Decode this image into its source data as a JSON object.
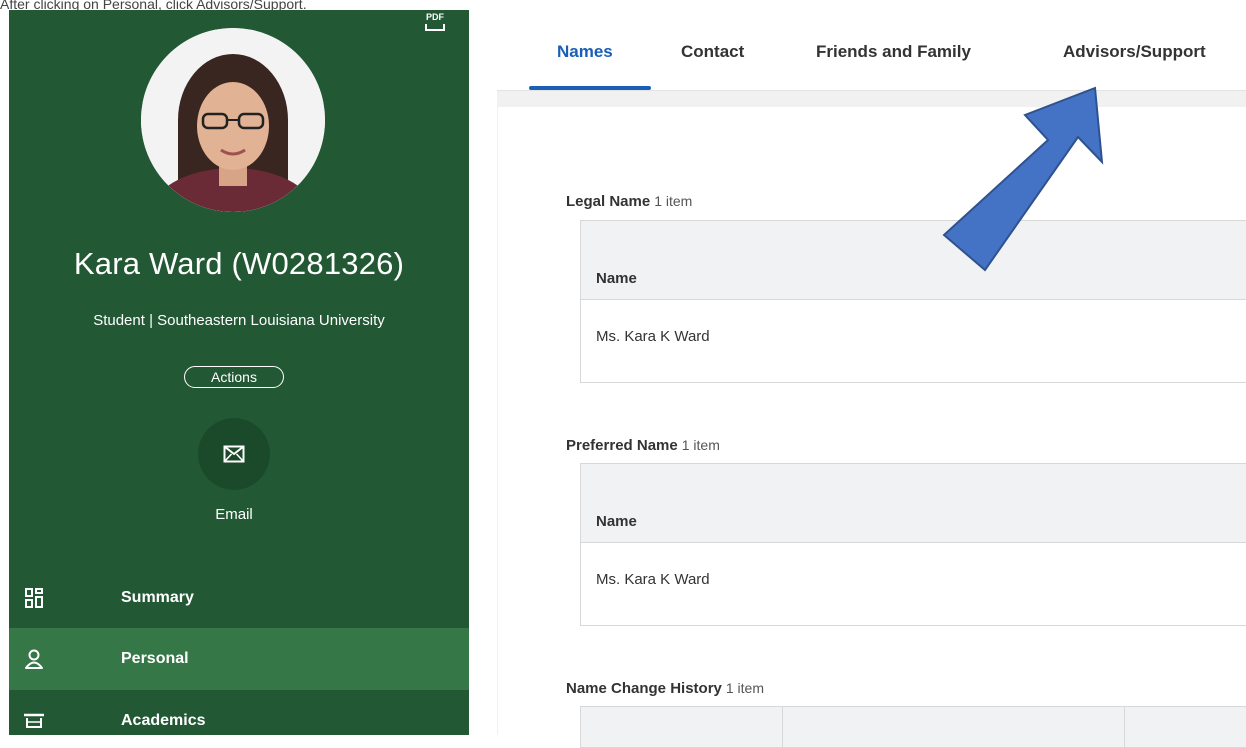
{
  "caption": "After clicking on Personal, click Advisors/Support.",
  "colors": {
    "sidebar": "#235834",
    "sidebar_active": "#357747",
    "tab_active": "#1a5fb4",
    "arrow": "#4472c4"
  },
  "profile": {
    "pdf_icon": "pdf-icon",
    "name": "Kara Ward (W0281326)",
    "subtitle": "Student | Southeastern Louisiana University",
    "actions_label": "Actions",
    "email_label": "Email"
  },
  "nav": {
    "items": [
      {
        "label": "Summary",
        "icon": "grid-icon",
        "active": false
      },
      {
        "label": "Personal",
        "icon": "person-icon",
        "active": true
      },
      {
        "label": "Academics",
        "icon": "mortarboard-icon",
        "active": false
      }
    ]
  },
  "tabs": [
    {
      "label": "Names",
      "active": true
    },
    {
      "label": "Contact",
      "active": false
    },
    {
      "label": "Friends and Family",
      "active": false
    },
    {
      "label": "Advisors/Support",
      "active": false
    }
  ],
  "sections": {
    "legal": {
      "title": "Legal Name",
      "count": "1 item",
      "column": "Name",
      "value": "Ms. Kara K Ward"
    },
    "preferred": {
      "title": "Preferred Name",
      "count": "1 item",
      "column": "Name",
      "value": "Ms. Kara K Ward"
    },
    "history": {
      "title": "Name Change History",
      "count": "1 item"
    }
  }
}
